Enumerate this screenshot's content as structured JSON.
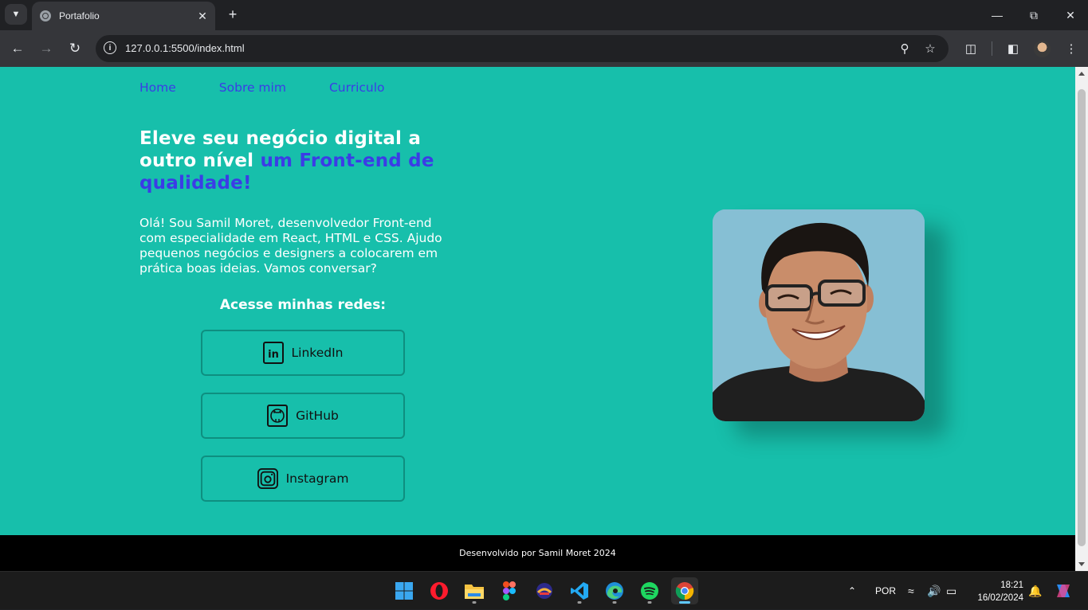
{
  "browser": {
    "tab_title": "Portafolio",
    "url": "127.0.0.1:5500/index.html"
  },
  "nav": {
    "items": [
      "Home",
      "Sobre mim",
      "Curriculo"
    ]
  },
  "hero": {
    "title_main": "Eleve seu negócio digital a outro nível ",
    "title_accent": "um Front-end de qualidade!",
    "description": "Olá! Sou Samil Moret, desenvolvedor Front-end com especialidade em React, HTML e CSS. Ajudo pequenos negócios e designers a colocarem em prática boas ideias. Vamos conversar?"
  },
  "social": {
    "title": "Acesse minhas redes:",
    "buttons": [
      {
        "label": "LinkedIn",
        "icon": "linkedin-icon"
      },
      {
        "label": "GitHub",
        "icon": "github-icon"
      },
      {
        "label": "Instagram",
        "icon": "instagram-icon"
      }
    ]
  },
  "footer": {
    "text": "Desenvolvido por Samil Moret 2024"
  },
  "taskbar": {
    "language": "POR",
    "time": "18:21",
    "date": "16/02/2024",
    "apps": [
      "windows-start-icon",
      "opera-icon",
      "file-explorer-icon",
      "figma-icon",
      "app-icon",
      "vscode-icon",
      "edge-icon",
      "spotify-icon",
      "chrome-icon"
    ]
  },
  "colors": {
    "page_background": "#17bfab",
    "accent": "#3b3ce6",
    "footer_background": "#000000",
    "button_border": "#0e8f80"
  }
}
